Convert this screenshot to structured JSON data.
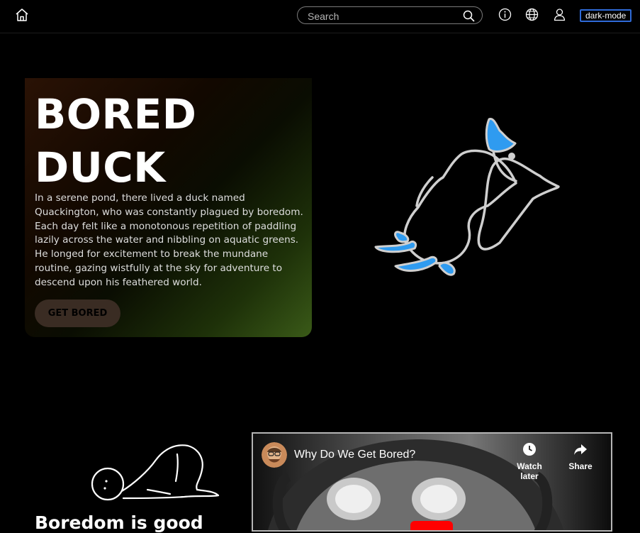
{
  "header": {
    "search_placeholder": "Search",
    "dark_mode_label": "dark-mode",
    "icons": [
      "home-icon",
      "search-icon",
      "info-icon",
      "globe-icon",
      "user-icon"
    ]
  },
  "hero": {
    "title_line1": "BORED",
    "title_line2": "DUCK",
    "description": "In a serene pond, there lived a duck named Quackington, who was constantly plagued by boredom. Each day felt like a monotonous repetition of paddling lazily across the water and nibbling on aquatic greens. He longed for excitement to break the mundane routine, gazing wistfully at the sky for adventure to descend upon his feathered world.",
    "cta_label": "GET BORED"
  },
  "section": {
    "title": "Boredom is good"
  },
  "video": {
    "title": "Why Do We Get Bored?",
    "watch_later_label": "Watch later",
    "share_label": "Share"
  },
  "colors": {
    "accent_blue": "#2f9bf0",
    "dark_mode_border": "#2f6bd8",
    "youtube_red": "#ff0000"
  }
}
